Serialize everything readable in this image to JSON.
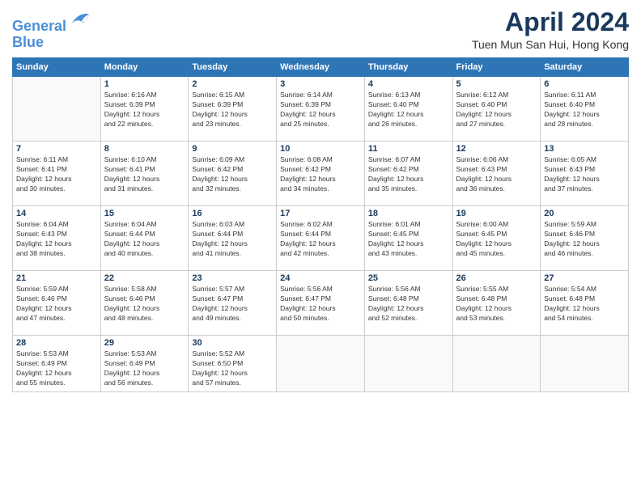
{
  "logo": {
    "line1": "General",
    "line2": "Blue"
  },
  "header": {
    "month_year": "April 2024",
    "location": "Tuen Mun San Hui, Hong Kong"
  },
  "weekdays": [
    "Sunday",
    "Monday",
    "Tuesday",
    "Wednesday",
    "Thursday",
    "Friday",
    "Saturday"
  ],
  "weeks": [
    [
      {
        "day": "",
        "info": ""
      },
      {
        "day": "1",
        "info": "Sunrise: 6:16 AM\nSunset: 6:39 PM\nDaylight: 12 hours\nand 22 minutes."
      },
      {
        "day": "2",
        "info": "Sunrise: 6:15 AM\nSunset: 6:39 PM\nDaylight: 12 hours\nand 23 minutes."
      },
      {
        "day": "3",
        "info": "Sunrise: 6:14 AM\nSunset: 6:39 PM\nDaylight: 12 hours\nand 25 minutes."
      },
      {
        "day": "4",
        "info": "Sunrise: 6:13 AM\nSunset: 6:40 PM\nDaylight: 12 hours\nand 26 minutes."
      },
      {
        "day": "5",
        "info": "Sunrise: 6:12 AM\nSunset: 6:40 PM\nDaylight: 12 hours\nand 27 minutes."
      },
      {
        "day": "6",
        "info": "Sunrise: 6:11 AM\nSunset: 6:40 PM\nDaylight: 12 hours\nand 28 minutes."
      }
    ],
    [
      {
        "day": "7",
        "info": "Sunrise: 6:11 AM\nSunset: 6:41 PM\nDaylight: 12 hours\nand 30 minutes."
      },
      {
        "day": "8",
        "info": "Sunrise: 6:10 AM\nSunset: 6:41 PM\nDaylight: 12 hours\nand 31 minutes."
      },
      {
        "day": "9",
        "info": "Sunrise: 6:09 AM\nSunset: 6:42 PM\nDaylight: 12 hours\nand 32 minutes."
      },
      {
        "day": "10",
        "info": "Sunrise: 6:08 AM\nSunset: 6:42 PM\nDaylight: 12 hours\nand 34 minutes."
      },
      {
        "day": "11",
        "info": "Sunrise: 6:07 AM\nSunset: 6:42 PM\nDaylight: 12 hours\nand 35 minutes."
      },
      {
        "day": "12",
        "info": "Sunrise: 6:06 AM\nSunset: 6:43 PM\nDaylight: 12 hours\nand 36 minutes."
      },
      {
        "day": "13",
        "info": "Sunrise: 6:05 AM\nSunset: 6:43 PM\nDaylight: 12 hours\nand 37 minutes."
      }
    ],
    [
      {
        "day": "14",
        "info": "Sunrise: 6:04 AM\nSunset: 6:43 PM\nDaylight: 12 hours\nand 38 minutes."
      },
      {
        "day": "15",
        "info": "Sunrise: 6:04 AM\nSunset: 6:44 PM\nDaylight: 12 hours\nand 40 minutes."
      },
      {
        "day": "16",
        "info": "Sunrise: 6:03 AM\nSunset: 6:44 PM\nDaylight: 12 hours\nand 41 minutes."
      },
      {
        "day": "17",
        "info": "Sunrise: 6:02 AM\nSunset: 6:44 PM\nDaylight: 12 hours\nand 42 minutes."
      },
      {
        "day": "18",
        "info": "Sunrise: 6:01 AM\nSunset: 6:45 PM\nDaylight: 12 hours\nand 43 minutes."
      },
      {
        "day": "19",
        "info": "Sunrise: 6:00 AM\nSunset: 6:45 PM\nDaylight: 12 hours\nand 45 minutes."
      },
      {
        "day": "20",
        "info": "Sunrise: 5:59 AM\nSunset: 6:46 PM\nDaylight: 12 hours\nand 46 minutes."
      }
    ],
    [
      {
        "day": "21",
        "info": "Sunrise: 5:59 AM\nSunset: 6:46 PM\nDaylight: 12 hours\nand 47 minutes."
      },
      {
        "day": "22",
        "info": "Sunrise: 5:58 AM\nSunset: 6:46 PM\nDaylight: 12 hours\nand 48 minutes."
      },
      {
        "day": "23",
        "info": "Sunrise: 5:57 AM\nSunset: 6:47 PM\nDaylight: 12 hours\nand 49 minutes."
      },
      {
        "day": "24",
        "info": "Sunrise: 5:56 AM\nSunset: 6:47 PM\nDaylight: 12 hours\nand 50 minutes."
      },
      {
        "day": "25",
        "info": "Sunrise: 5:56 AM\nSunset: 6:48 PM\nDaylight: 12 hours\nand 52 minutes."
      },
      {
        "day": "26",
        "info": "Sunrise: 5:55 AM\nSunset: 6:48 PM\nDaylight: 12 hours\nand 53 minutes."
      },
      {
        "day": "27",
        "info": "Sunrise: 5:54 AM\nSunset: 6:48 PM\nDaylight: 12 hours\nand 54 minutes."
      }
    ],
    [
      {
        "day": "28",
        "info": "Sunrise: 5:53 AM\nSunset: 6:49 PM\nDaylight: 12 hours\nand 55 minutes."
      },
      {
        "day": "29",
        "info": "Sunrise: 5:53 AM\nSunset: 6:49 PM\nDaylight: 12 hours\nand 56 minutes."
      },
      {
        "day": "30",
        "info": "Sunrise: 5:52 AM\nSunset: 6:50 PM\nDaylight: 12 hours\nand 57 minutes."
      },
      {
        "day": "",
        "info": ""
      },
      {
        "day": "",
        "info": ""
      },
      {
        "day": "",
        "info": ""
      },
      {
        "day": "",
        "info": ""
      }
    ]
  ]
}
